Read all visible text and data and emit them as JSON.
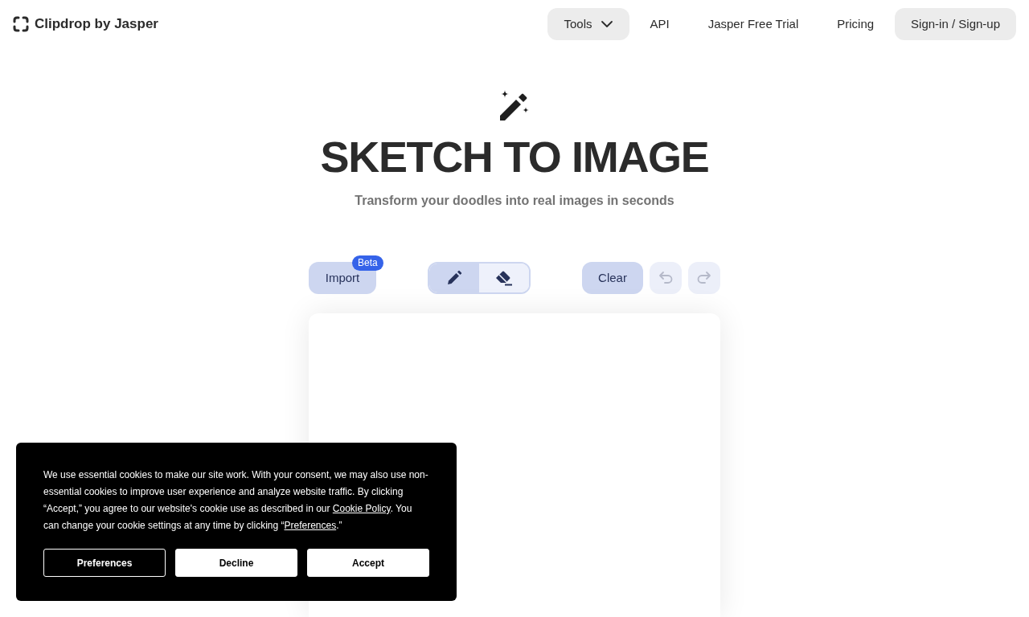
{
  "header": {
    "logo": "Clipdrop by Jasper",
    "nav": [
      {
        "label": "Tools",
        "kind": "dropdown"
      },
      {
        "label": "API",
        "kind": "link"
      },
      {
        "label": "Jasper Free Trial",
        "kind": "link"
      },
      {
        "label": "Pricing",
        "kind": "link"
      },
      {
        "label": "Sign-in / Sign-up",
        "kind": "button"
      }
    ]
  },
  "hero": {
    "title": "SKETCH TO IMAGE",
    "subtitle": "Transform your doodles into real images in seconds"
  },
  "toolbar": {
    "import": {
      "label": "Import",
      "badge": "Beta"
    },
    "tools": [
      {
        "kind": "pencil",
        "selected": true
      },
      {
        "kind": "eraser",
        "selected": false
      }
    ],
    "clear": "Clear",
    "history": [
      {
        "kind": "undo",
        "disabled": true
      },
      {
        "kind": "redo",
        "disabled": true
      }
    ]
  },
  "cookie_banner": {
    "text": [
      {
        "kind": "text",
        "text": "We use essential cookies to make our site work. With your consent, we may also use non-essential cookies to improve user experience and analyze website traffic. By clicking “Accept,” you agree to our website's cookie use as described in our "
      },
      {
        "kind": "link",
        "text": "Cookie Policy"
      },
      {
        "kind": "text",
        "text": ". You can change your cookie settings at any time by clicking “"
      },
      {
        "kind": "link",
        "text": "Preferences"
      },
      {
        "kind": "text",
        "text": ".”"
      }
    ],
    "buttons": [
      {
        "label": "Preferences",
        "kind": "outline"
      },
      {
        "label": "Decline",
        "kind": "solid"
      },
      {
        "label": "Accept",
        "kind": "solid"
      }
    ]
  }
}
